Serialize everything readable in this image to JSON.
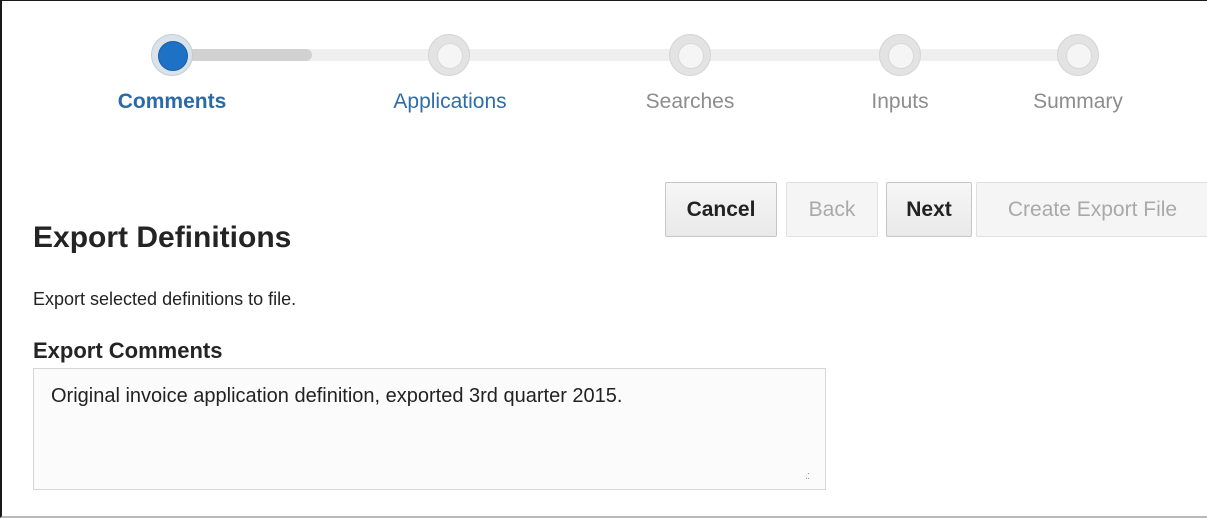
{
  "train": {
    "steps": [
      {
        "label": "Comments",
        "state": "current"
      },
      {
        "label": "Applications",
        "state": "active"
      },
      {
        "label": "Searches",
        "state": "inactive"
      },
      {
        "label": "Inputs",
        "state": "inactive"
      },
      {
        "label": "Summary",
        "state": "inactive"
      }
    ]
  },
  "toolbar": {
    "cancel_label": "Cancel",
    "back_label": "Back",
    "next_label": "Next",
    "create_label": "Create Export File"
  },
  "page": {
    "title": "Export Definitions",
    "description": "Export selected definitions to file."
  },
  "comments": {
    "label": "Export Comments",
    "value": "Original invoice application definition, exported 3rd quarter 2015."
  },
  "colors": {
    "current_step": "#1e72c5",
    "link_text": "#2f6da9",
    "disabled_text": "#a9a9a9"
  }
}
